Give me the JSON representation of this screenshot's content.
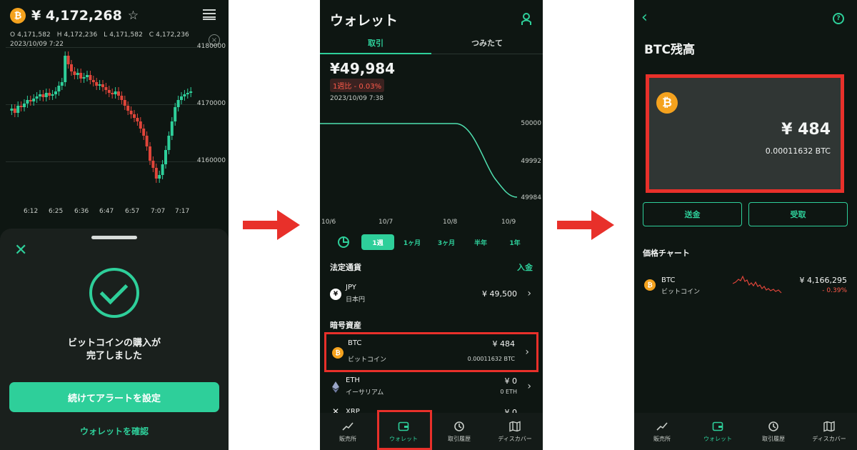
{
  "panel1": {
    "price": "¥ 4,172,268",
    "ohlc": "O 4,171,582   H 4,172,236   L 4,171,582   C 4,172,236",
    "datetime": "2023/10/09 7:22",
    "y_ticks": [
      "4180000",
      "4170000",
      "4160000"
    ],
    "x_ticks": [
      "6:12",
      "6:25",
      "6:36",
      "6:47",
      "6:57",
      "7:07",
      "7:17"
    ],
    "sheet": {
      "message_line1": "ビットコインの購入が",
      "message_line2": "完了しました",
      "primary_button": "続けてアラートを設定",
      "link": "ウォレットを確認"
    }
  },
  "panel2": {
    "title": "ウォレット",
    "tabs": [
      "取引",
      "つみたて"
    ],
    "balance": "¥49,984",
    "change": "1週比 - 0.03%",
    "datetime": "2023/10/09 7:38",
    "y_labels": [
      "50000",
      "49992",
      "49984"
    ],
    "x_labels": [
      "10/6",
      "10/7",
      "10/8",
      "10/9"
    ],
    "periods": [
      "1週",
      "1ヶ月",
      "3ヶ月",
      "半年",
      "1年"
    ],
    "fiat_section": "法定通貨",
    "deposit_link": "入金",
    "crypto_section": "暗号資産",
    "rows": [
      {
        "symbol": "JPY",
        "name": "日本円",
        "value": "¥ 49,500",
        "sub": ""
      },
      {
        "symbol": "BTC",
        "name": "ビットコイン",
        "value": "¥ 484",
        "sub": "0.00011632 BTC"
      },
      {
        "symbol": "ETH",
        "name": "イーサリアム",
        "value": "¥ 0",
        "sub": "0 ETH"
      },
      {
        "symbol": "XRP",
        "name": "",
        "value": "¥ 0",
        "sub": ""
      }
    ]
  },
  "panel3": {
    "title": "BTC残高",
    "amount": "¥ 484",
    "btc_amount": "0.00011632 BTC",
    "send_button": "送金",
    "receive_button": "受取",
    "price_chart_title": "価格チャート",
    "row": {
      "symbol": "BTC",
      "name": "ビットコイン",
      "value": "¥ 4,166,295",
      "change": "- 0.39%"
    }
  },
  "nav": [
    "販売所",
    "ウォレット",
    "取引履歴",
    "ディスカバー"
  ],
  "colors": {
    "accent": "#2ecf9a",
    "highlight": "#e8302a",
    "negative": "#ff5a4a",
    "bitcoin": "#f4a21e",
    "background": "#0e1612"
  }
}
